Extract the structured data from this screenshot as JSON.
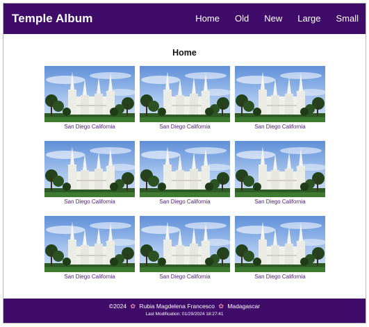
{
  "header": {
    "title": "Temple Album",
    "nav": [
      "Home",
      "Old",
      "New",
      "Large",
      "Small"
    ]
  },
  "main": {
    "title": "Home",
    "cards": [
      {
        "caption": "San Diego California"
      },
      {
        "caption": "San Diego California"
      },
      {
        "caption": "San Diego California"
      },
      {
        "caption": "San Diego California"
      },
      {
        "caption": "San Diego California"
      },
      {
        "caption": "San Diego California"
      },
      {
        "caption": "San Diego California"
      },
      {
        "caption": "San Diego California"
      },
      {
        "caption": "San Diego California"
      }
    ]
  },
  "footer": {
    "copyright": "©2024",
    "author": "Rubia Magdelena Francesco",
    "location": "Madagascar",
    "last_modified": "Last Modification: 01/29/2024 18:27:41"
  },
  "colors": {
    "brand_purple": "#400c6a",
    "caption_purple": "#4b1a78",
    "flower_pink": "#e68ab0"
  }
}
